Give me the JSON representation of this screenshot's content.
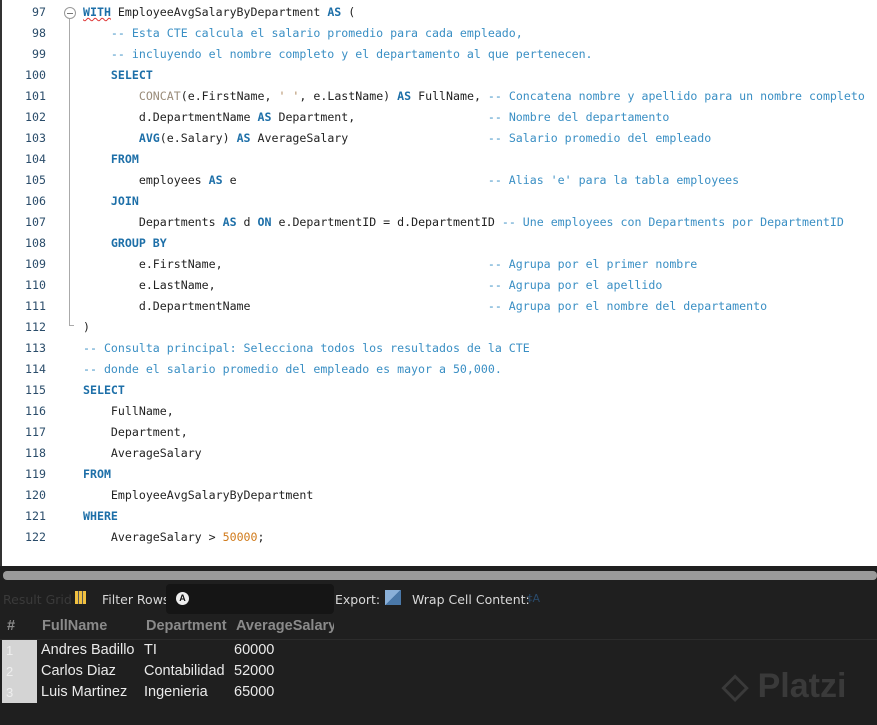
{
  "editor": {
    "lines": [
      {
        "num": "97",
        "tokens": [
          [
            "ku",
            "WITH"
          ],
          [
            "t",
            " EmployeeAvgSalaryByDepartment "
          ],
          [
            "k",
            "AS"
          ],
          [
            "t",
            " ("
          ]
        ]
      },
      {
        "num": "98",
        "tokens": [
          [
            "c",
            "    -- Esta CTE calcula el salario promedio para cada empleado,"
          ]
        ]
      },
      {
        "num": "99",
        "tokens": [
          [
            "c",
            "    -- incluyendo el nombre completo y el departamento al que pertenecen."
          ]
        ]
      },
      {
        "num": "100",
        "tokens": [
          [
            "t",
            "    "
          ],
          [
            "k",
            "SELECT"
          ]
        ]
      },
      {
        "num": "101",
        "tokens": [
          [
            "t",
            "        "
          ],
          [
            "f",
            "CONCAT"
          ],
          [
            "t",
            "(e.FirstName, "
          ],
          [
            "s",
            "' '"
          ],
          [
            "t",
            ", e.LastName) "
          ],
          [
            "k",
            "AS"
          ],
          [
            "t",
            " FullName, "
          ],
          [
            "c",
            "-- Concatena nombre y apellido para un nombre completo"
          ]
        ]
      },
      {
        "num": "102",
        "tokens": [
          [
            "t",
            "        d.DepartmentName "
          ],
          [
            "k",
            "AS"
          ],
          [
            "t",
            " Department,                   "
          ],
          [
            "c",
            "-- Nombre del departamento"
          ]
        ]
      },
      {
        "num": "103",
        "tokens": [
          [
            "t",
            "        "
          ],
          [
            "k",
            "AVG"
          ],
          [
            "t",
            "(e.Salary) "
          ],
          [
            "k",
            "AS"
          ],
          [
            "t",
            " AverageSalary                    "
          ],
          [
            "c",
            "-- Salario promedio del empleado"
          ]
        ]
      },
      {
        "num": "104",
        "tokens": [
          [
            "t",
            "    "
          ],
          [
            "k",
            "FROM"
          ]
        ]
      },
      {
        "num": "105",
        "tokens": [
          [
            "t",
            "        employees "
          ],
          [
            "k",
            "AS"
          ],
          [
            "t",
            " e                                    "
          ],
          [
            "c",
            "-- Alias 'e' para la tabla employees"
          ]
        ]
      },
      {
        "num": "106",
        "tokens": [
          [
            "t",
            "    "
          ],
          [
            "k",
            "JOIN"
          ]
        ]
      },
      {
        "num": "107",
        "tokens": [
          [
            "t",
            "        Departments "
          ],
          [
            "k",
            "AS"
          ],
          [
            "t",
            " d "
          ],
          [
            "k",
            "ON"
          ],
          [
            "t",
            " e.DepartmentID = d.DepartmentID "
          ],
          [
            "c",
            "-- Une employees con Departments por DepartmentID"
          ]
        ]
      },
      {
        "num": "108",
        "tokens": [
          [
            "t",
            "    "
          ],
          [
            "k",
            "GROUP BY"
          ]
        ]
      },
      {
        "num": "109",
        "tokens": [
          [
            "t",
            "        e.FirstName,                                      "
          ],
          [
            "c",
            "-- Agrupa por el primer nombre"
          ]
        ]
      },
      {
        "num": "110",
        "tokens": [
          [
            "t",
            "        e.LastName,                                       "
          ],
          [
            "c",
            "-- Agrupa por el apellido"
          ]
        ]
      },
      {
        "num": "111",
        "tokens": [
          [
            "t",
            "        d.DepartmentName                                  "
          ],
          [
            "c",
            "-- Agrupa por el nombre del departamento"
          ]
        ]
      },
      {
        "num": "112",
        "tokens": [
          [
            "t",
            ")"
          ]
        ]
      },
      {
        "num": "113",
        "tokens": [
          [
            "c",
            "-- Consulta principal: Selecciona todos los resultados de la CTE"
          ]
        ]
      },
      {
        "num": "114",
        "tokens": [
          [
            "c",
            "-- donde el salario promedio del empleado es mayor a 50,000."
          ]
        ]
      },
      {
        "num": "115",
        "tokens": [
          [
            "k",
            "SELECT"
          ]
        ]
      },
      {
        "num": "116",
        "tokens": [
          [
            "t",
            "    FullName,"
          ]
        ]
      },
      {
        "num": "117",
        "tokens": [
          [
            "t",
            "    Department,"
          ]
        ]
      },
      {
        "num": "118",
        "tokens": [
          [
            "t",
            "    AverageSalary"
          ]
        ]
      },
      {
        "num": "119",
        "tokens": [
          [
            "k",
            "FROM"
          ]
        ]
      },
      {
        "num": "120",
        "tokens": [
          [
            "t",
            "    EmployeeAvgSalaryByDepartment"
          ]
        ]
      },
      {
        "num": "121",
        "tokens": [
          [
            "k",
            "WHERE"
          ]
        ]
      },
      {
        "num": "122",
        "tokens": [
          [
            "t",
            "    AverageSalary > "
          ],
          [
            "n",
            "50000"
          ],
          [
            "t",
            ";"
          ]
        ]
      }
    ]
  },
  "toolbar": {
    "result_grid": "Result Grid",
    "filter_rows": "Filter Rows:",
    "search_glyph": "A",
    "export": "Export:",
    "wrap": "Wrap Cell Content:",
    "wrap_icon": "‡A"
  },
  "grid": {
    "columns": [
      "#",
      "FullName",
      "Department",
      "AverageSalary"
    ],
    "rows": [
      {
        "n": "1",
        "full": "Andres Badillo",
        "dept": "TI",
        "avg": "60000"
      },
      {
        "n": "2",
        "full": "Carlos Diaz",
        "dept": "Contabilidad",
        "avg": "52000"
      },
      {
        "n": "3",
        "full": "Luis Martinez",
        "dept": "Ingenieria",
        "avg": "65000"
      }
    ]
  },
  "watermark": "Platzi"
}
